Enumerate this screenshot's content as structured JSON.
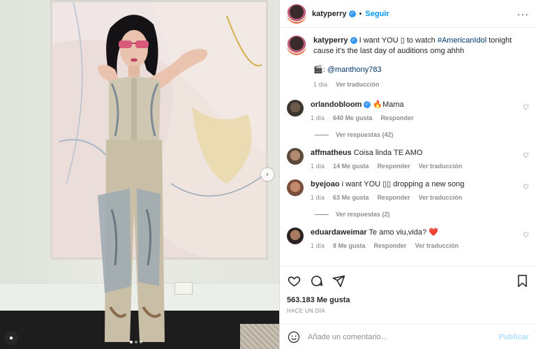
{
  "post": {
    "author": "katyperry",
    "follow_label": "Seguir",
    "separator": "•",
    "more_label": "···"
  },
  "caption": {
    "author": "katyperry",
    "text_before": " I want YOU ",
    "unknown_glyph": "▯",
    "text_mid": " to watch ",
    "hashtag": "#AmericanIdol",
    "text_after": " tonight cause it's the last day of auditions omg ahhh",
    "credit_icon": "🎬",
    "credit": ": @manthony783",
    "time": "1 día",
    "translate": "Ver traducción"
  },
  "comments": [
    {
      "user": "orlandobloom",
      "verified": true,
      "text": " 🔥Mama",
      "time": "1 día",
      "likes": "640 Me gusta",
      "reply": "Responder",
      "translate": "",
      "replies": "Ver respuestas (42)",
      "avatar": "o"
    },
    {
      "user": "affmatheus",
      "verified": false,
      "text": " Coisa linda TE AMO",
      "time": "1 día",
      "likes": "14 Me gusta",
      "reply": "Responder",
      "translate": "Ver traducción",
      "replies": "",
      "avatar": "a"
    },
    {
      "user": "byejoao",
      "verified": false,
      "text": " i want YOU ▯▯ dropping a new song",
      "time": "1 día",
      "likes": "63 Me gusta",
      "reply": "Responder",
      "translate": "Ver traducción",
      "replies": "Ver respuestas (2)",
      "avatar": "b"
    },
    {
      "user": "eduardaweimar",
      "verified": false,
      "text": " Te amo viu,vida? ❤️",
      "time": "1 día",
      "likes": "8 Me gusta",
      "reply": "Responder",
      "translate": "Ver traducción",
      "replies": "",
      "avatar": "e"
    }
  ],
  "stats": {
    "likes": "563.183 Me gusta",
    "date": "HACE UN DÍA"
  },
  "composer": {
    "placeholder": "Añade un comentario...",
    "publish": "Publicar"
  },
  "icons": {
    "like": "heart-icon",
    "comment": "comment-icon",
    "share": "share-icon",
    "save": "bookmark-icon",
    "emoji": "emoji-icon",
    "next": "chevron-right-icon",
    "tag": "user-tag-icon"
  },
  "colors": {
    "accent": "#0095f6",
    "verified": "#3897f0",
    "muted": "#8e8e8e"
  }
}
